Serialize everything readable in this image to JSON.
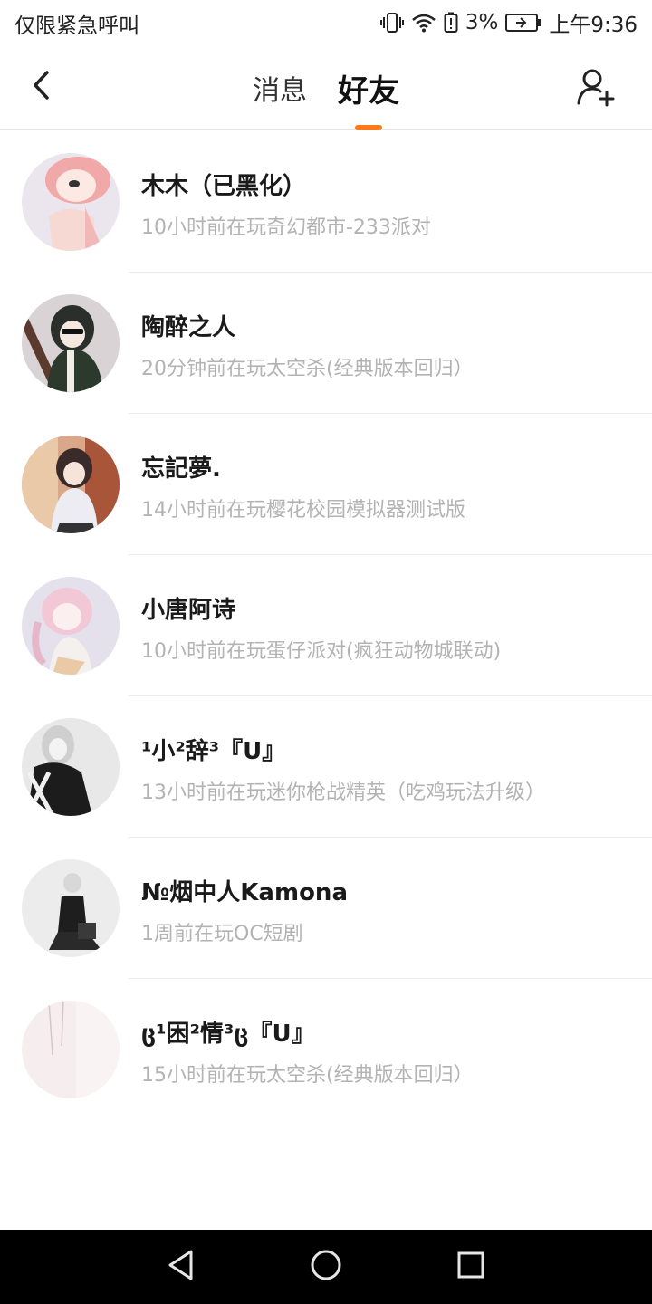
{
  "status_bar": {
    "left_text": "仅限紧急呼叫",
    "battery_percent": "3%",
    "time": "上午9:36",
    "icons": [
      "vibrate-icon",
      "wifi-icon",
      "battery-saver-icon",
      "battery-icon"
    ]
  },
  "header": {
    "tab_messages": "消息",
    "tab_friends": "好友",
    "active_tab": "好友",
    "accent_color": "#ff7a1a",
    "icons": [
      "back-arrow-icon",
      "add-friend-icon"
    ]
  },
  "friends": [
    {
      "name": "木木（已黑化）",
      "status": "10小时前在玩奇幻都市-233派对"
    },
    {
      "name": "陶醉之人",
      "status": "20分钟前在玩太空杀(经典版本回归）"
    },
    {
      "name": "忘記夢.",
      "status": "14小时前在玩樱花校园模拟器测试版"
    },
    {
      "name": "小唐阿诗",
      "status": "10小时前在玩蛋仔派对(疯狂动物城联动)"
    },
    {
      "name": "¹小²辞³『U』",
      "status": "13小时前在玩迷你枪战精英（吃鸡玩法升级）"
    },
    {
      "name": "№烟中人Kamona",
      "status": "1周前在玩OC短剧"
    },
    {
      "name": "ც¹困²情³ც『U』",
      "status": "15小时前在玩太空杀(经典版本回归）"
    }
  ],
  "nav_bar": {
    "icons": [
      "back-triangle-icon",
      "home-circle-icon",
      "recents-square-icon"
    ]
  }
}
